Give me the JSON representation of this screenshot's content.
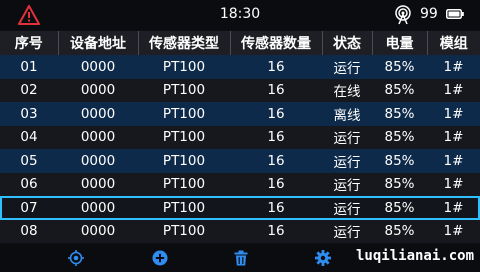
{
  "status": {
    "time": "18:30",
    "battery_level": "99",
    "alert_color": "#e2313a"
  },
  "table": {
    "headers": [
      "序号",
      "设备地址",
      "传感器类型",
      "传感器数量",
      "状态",
      "电量",
      "模组"
    ],
    "rows": [
      {
        "no": "01",
        "addr": "0000",
        "type": "PT100",
        "count": "16",
        "state": "运行",
        "battery": "85%",
        "module": "1#",
        "state_kind": "run"
      },
      {
        "no": "02",
        "addr": "0000",
        "type": "PT100",
        "count": "16",
        "state": "在线",
        "battery": "85%",
        "module": "1#",
        "state_kind": "online"
      },
      {
        "no": "03",
        "addr": "0000",
        "type": "PT100",
        "count": "16",
        "state": "离线",
        "battery": "85%",
        "module": "1#",
        "state_kind": "offline"
      },
      {
        "no": "04",
        "addr": "0000",
        "type": "PT100",
        "count": "16",
        "state": "运行",
        "battery": "85%",
        "module": "1#",
        "state_kind": "run"
      },
      {
        "no": "05",
        "addr": "0000",
        "type": "PT100",
        "count": "16",
        "state": "运行",
        "battery": "85%",
        "module": "1#",
        "state_kind": "run"
      },
      {
        "no": "06",
        "addr": "0000",
        "type": "PT100",
        "count": "16",
        "state": "运行",
        "battery": "85%",
        "module": "1#",
        "state_kind": "run"
      },
      {
        "no": "07",
        "addr": "0000",
        "type": "PT100",
        "count": "16",
        "state": "运行",
        "battery": "85%",
        "module": "1#",
        "state_kind": "run",
        "selected": true
      },
      {
        "no": "08",
        "addr": "0000",
        "type": "PT100",
        "count": "16",
        "state": "运行",
        "battery": "85%",
        "module": "1#",
        "state_kind": "run"
      }
    ]
  },
  "toolbar": {
    "icons": [
      "locate-icon",
      "add-icon",
      "delete-icon",
      "settings-icon"
    ],
    "accent": "#2f8df0"
  },
  "watermark": "luqilianai.com"
}
